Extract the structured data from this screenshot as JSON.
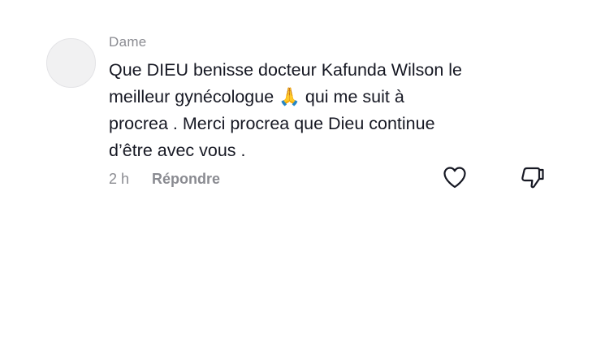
{
  "comment": {
    "author": "Dame",
    "text_lines": [
      "Que DIEU benisse docteur Kafunda Wilson le",
      "meilleur gynécologue 🙏 qui me suit à",
      "procrea . Merci procrea que Dieu continue",
      "d’être avec vous ."
    ],
    "time": "2 h",
    "reply_label": "Répondre"
  },
  "icons": {
    "like": "heart-outline-icon",
    "dislike": "thumbs-down-icon"
  },
  "colors": {
    "text": "#161823",
    "secondary": "#8a8b91",
    "avatar_bg": "#f1f1f2"
  }
}
